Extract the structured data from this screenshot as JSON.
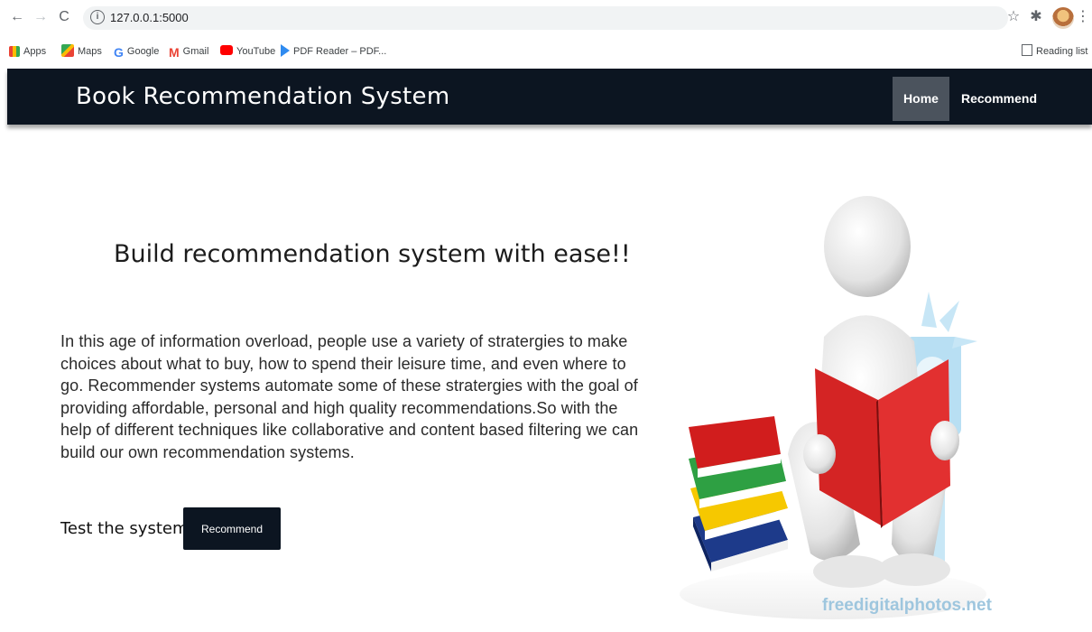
{
  "browser": {
    "url": "127.0.0.1:5000",
    "bookmarks": [
      {
        "label": "Apps",
        "icon": "apps-grid-icon"
      },
      {
        "label": "Maps",
        "icon": "maps-icon"
      },
      {
        "label": "Google",
        "icon": "google-icon"
      },
      {
        "label": "Gmail",
        "icon": "gmail-icon"
      },
      {
        "label": "YouTube",
        "icon": "youtube-icon"
      },
      {
        "label": "PDF Reader – PDF...",
        "icon": "pdf-reader-icon"
      }
    ],
    "reading_list": "Reading list"
  },
  "nav": {
    "brand": "Book Recommendation System",
    "home": "Home",
    "recommend": "Recommend"
  },
  "main": {
    "heading": "Build recommendation system with ease!!",
    "description": "In this age of information overload, people use a variety of stratergies to make choices about what to buy, how to spend their leisure time, and even where to go. Recommender systems automate some of these stratergies with the goal of providing affordable, personal and high quality recommendations.So with the help of different techniques like collaborative and content based filtering we can build our own recommendation systems.",
    "test_label": "Test the system",
    "recommend_button": "Recommend",
    "image_watermark": "freedigitalphotos.net"
  },
  "colors": {
    "navbar": "#0c1521",
    "active_nav": "#4b535d",
    "button": "#0c1521"
  }
}
